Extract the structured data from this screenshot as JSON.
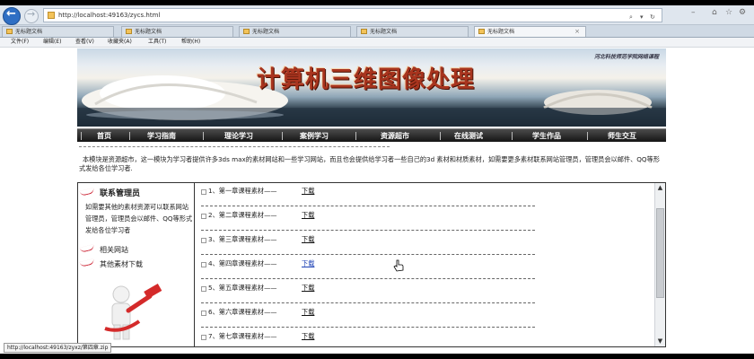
{
  "browser": {
    "url": "http://localhost:49163/zycs.html",
    "tabs": [
      {
        "label": "无标题文档",
        "active": false
      },
      {
        "label": "无标题文档",
        "active": false
      },
      {
        "label": "无标题文档",
        "active": false
      },
      {
        "label": "无标题文档",
        "active": false
      },
      {
        "label": "无标题文档",
        "active": true
      }
    ],
    "tab_close": "×",
    "menu": [
      "文件(F)",
      "编辑(E)",
      "查看(V)",
      "收藏夹(A)",
      "工具(T)",
      "帮助(H)"
    ],
    "status_url": "http://localhost:49163/zyxz/第四章.zip",
    "icons": [
      "back-arrow-icon",
      "forward-arrow-icon",
      "search-icon",
      "refresh-icon",
      "home-icon",
      "star-icon",
      "gear-icon"
    ]
  },
  "banner": {
    "title": "计算机三维图像处理",
    "tagline": "河北科技师范学院网络课程"
  },
  "nav": [
    "首页",
    "学习指南",
    "理论学习",
    "案例学习",
    "资源超市",
    "在线测试",
    "学生作品",
    "师生交互"
  ],
  "intro": "本模块是资源超市，这一模块为学习者提供许多3ds max的素材网站和一些学习网站，而且也会提供给学习者一些自己的3d   素材和材质素材，如需要更多素材联系网站管理员，管理员会以邮件、QQ等形式发给各位学习者.",
  "sidebar": {
    "contact_title": "联系管理员",
    "contact_desc": "如需要其他的素材资源可以联系网站管理员，管理员会以邮件、QQ等形式发给各位学习者",
    "links": [
      "相关网站",
      "其他素材下载"
    ]
  },
  "resources": [
    {
      "title": "1、第一章课程素材——",
      "link": "下载"
    },
    {
      "title": "2、第二章课程素材——",
      "link": "下载"
    },
    {
      "title": "3、第三章课程素材——",
      "link": "下载"
    },
    {
      "title": "4、第四章课程素材——",
      "link": "下载"
    },
    {
      "title": "5、第五章课程素材——",
      "link": "下载"
    },
    {
      "title": "6、第六章课程素材——",
      "link": "下载"
    },
    {
      "title": "7、第七章课程素材——",
      "link": "下载"
    }
  ],
  "colors": {
    "banner_title": "#a8341e",
    "nav_bg": "#1e1e1e",
    "accent_red": "#cc2233",
    "hover_link": "#1b3fb4"
  }
}
